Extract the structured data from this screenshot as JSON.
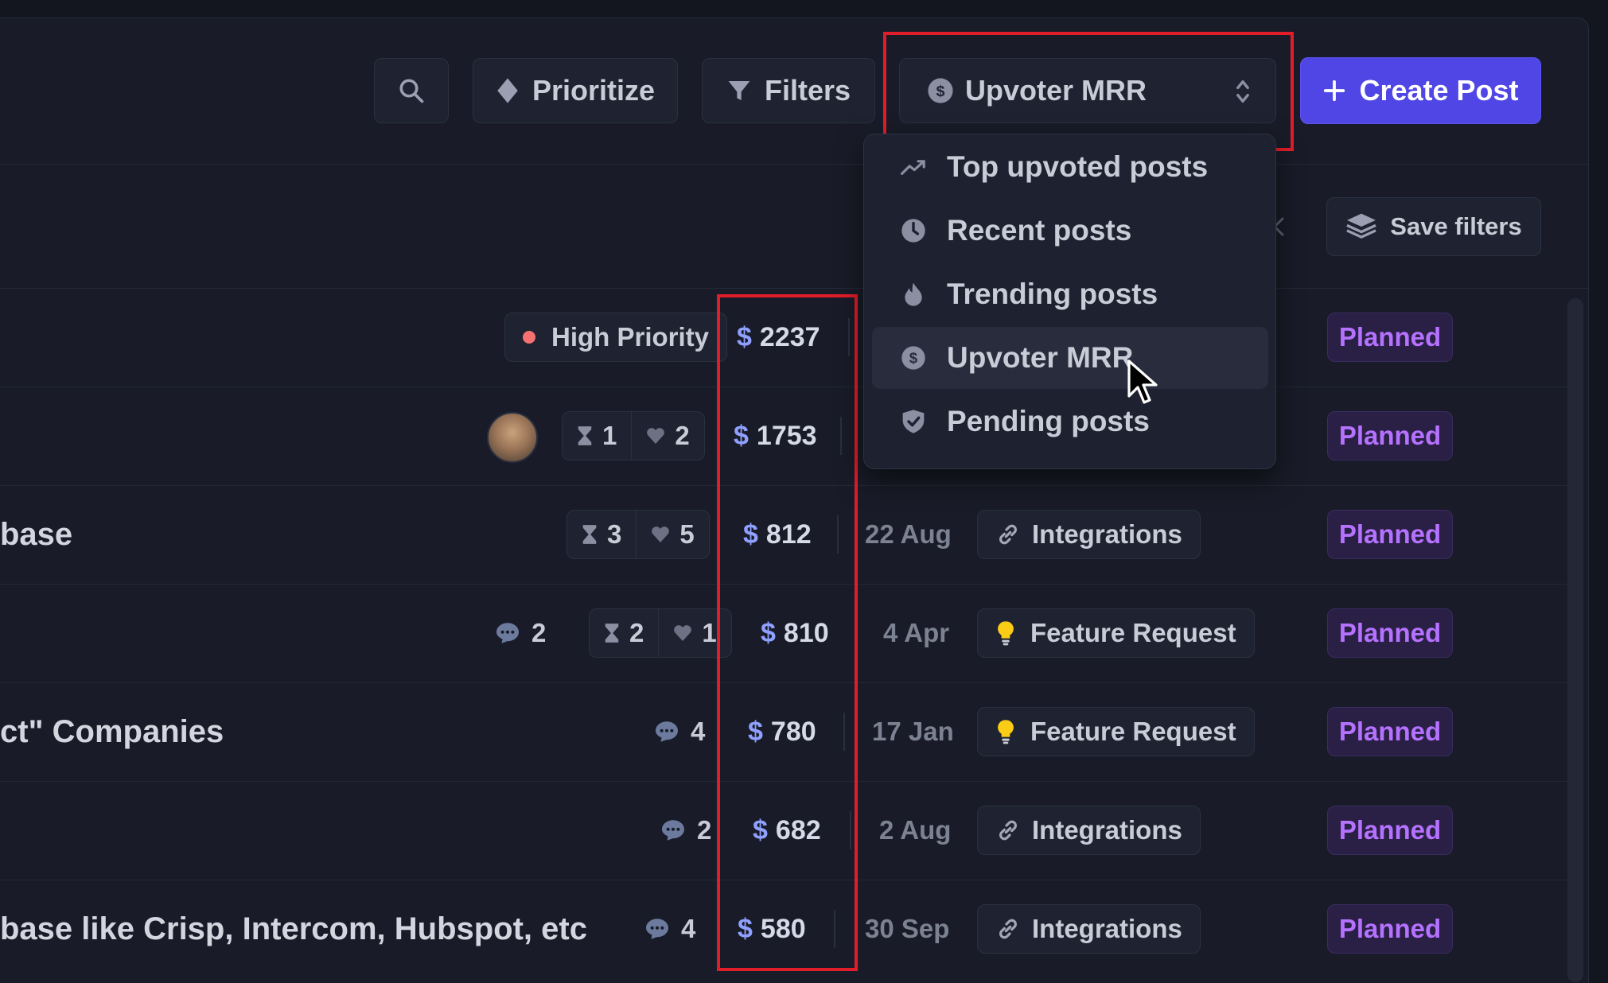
{
  "toolbar": {
    "search_icon": "search-icon",
    "prioritize_label": "Prioritize",
    "filters_label": "Filters",
    "sort_selected": "Upvoter MRR",
    "create_label": "Create Post",
    "save_filters_label": "Save filters"
  },
  "sort_menu": {
    "items": [
      {
        "label": "Top upvoted posts",
        "icon": "trending-up-icon"
      },
      {
        "label": "Recent posts",
        "icon": "clock-icon"
      },
      {
        "label": "Trending posts",
        "icon": "fire-icon"
      },
      {
        "label": "Upvoter MRR",
        "icon": "dollar-circle-icon",
        "active": true
      },
      {
        "label": "Pending posts",
        "icon": "shield-check-icon"
      }
    ]
  },
  "posts": [
    {
      "title": "",
      "priority": "High Priority",
      "currency": "$",
      "mrr": "2237",
      "status": "Planned"
    },
    {
      "title": "",
      "votes_a": "1",
      "votes_b": "2",
      "currency": "$",
      "mrr": "1753",
      "status": "Planned"
    },
    {
      "title": "base",
      "votes_a": "3",
      "votes_b": "5",
      "currency": "$",
      "mrr": "812",
      "date": "22 Aug",
      "category": "Integrations",
      "status": "Planned"
    },
    {
      "title": "",
      "comments": "2",
      "votes_a": "2",
      "votes_b": "1",
      "currency": "$",
      "mrr": "810",
      "date": "4 Apr",
      "category": "Feature Request",
      "status": "Planned"
    },
    {
      "title": "ct\" Companies",
      "comments": "4",
      "currency": "$",
      "mrr": "780",
      "date": "17 Jan",
      "category": "Feature Request",
      "status": "Planned"
    },
    {
      "title": "",
      "comments": "2",
      "currency": "$",
      "mrr": "682",
      "date": "2 Aug",
      "category": "Integrations",
      "status": "Planned"
    },
    {
      "title": "base like Crisp, Intercom, Hubspot, etc",
      "comments": "4",
      "currency": "$",
      "mrr": "580",
      "date": "30 Sep",
      "category": "Integrations",
      "status": "Planned"
    }
  ],
  "colors": {
    "background": "#191c28",
    "accent": "#4f46e5",
    "status_text": "#b572ff",
    "highlight": "#e11d2a"
  }
}
